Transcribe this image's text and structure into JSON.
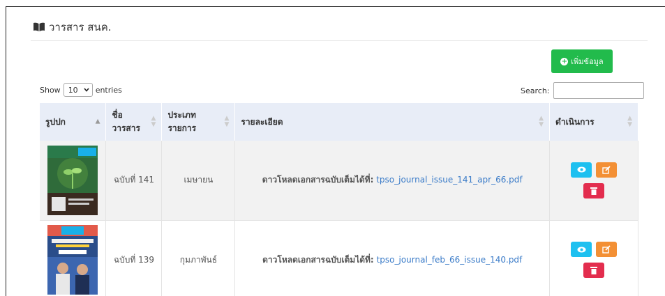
{
  "header": {
    "title": "วารสาร สนค.",
    "icon": "book-open-icon"
  },
  "toolbar": {
    "add_label": "เพิ่มข้อมูล"
  },
  "length_menu": {
    "show": "Show",
    "value": "10",
    "entries": "entries"
  },
  "search": {
    "label": "Search:",
    "value": ""
  },
  "table": {
    "columns": [
      "รูปปก",
      "ชื่อ วารสาร",
      "ประเภท รายการ",
      "รายละเอียด",
      "ดำเนินการ"
    ],
    "col2_line1": "ชื่อ",
    "col2_line2": "วารสาร",
    "col3_line1": "ประเภท",
    "col3_line2": "รายการ",
    "rows": [
      {
        "issue": "ฉบับที่ 141",
        "month": "เมษายน",
        "detail_label": "ดาวโหลดเอกสารฉบับเต็มได้ที่:",
        "file": "tpso_journal_issue_141_apr_66.pdf"
      },
      {
        "issue": "ฉบับที่ 139",
        "month": "กุมภาพันธ์",
        "detail_label": "ดาวโหลดเอกสารฉบับเต็มได้ที่:",
        "file": "tpso_journal_feb_66_issue_140.pdf"
      }
    ]
  },
  "colors": {
    "add": "#22bb4c",
    "view": "#1ec0f0",
    "edit": "#f39035",
    "delete": "#e32d4e",
    "link": "#3a7bc8"
  }
}
